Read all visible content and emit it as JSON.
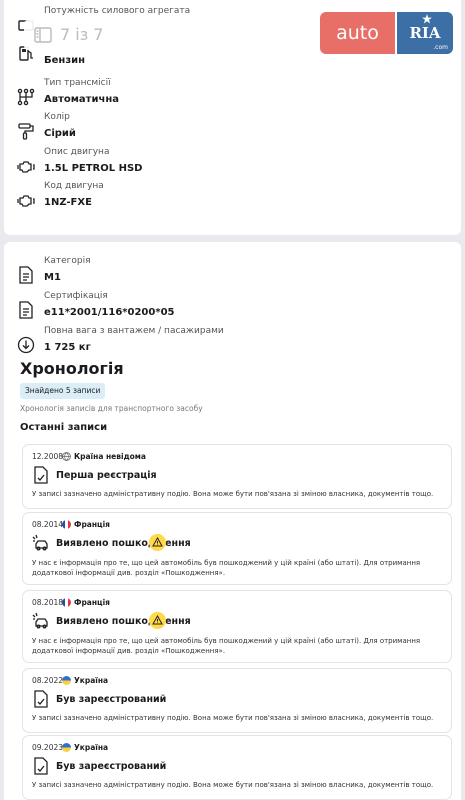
{
  "vehicle_specs": [
    {
      "label": "Потужність силового агрегата",
      "value": "",
      "icon": "engine-power-icon"
    },
    {
      "label": "",
      "value": "Бензин",
      "icon": "fuel-pump-icon"
    },
    {
      "label": "Тип трансмісії",
      "value": "Автоматична",
      "icon": "transmission-icon"
    },
    {
      "label": "Колір",
      "value": "Сірий",
      "icon": "paint-roller-icon"
    },
    {
      "label": "Опис двигуна",
      "value": "1.5L PETROL HSD",
      "icon": "engine-icon"
    },
    {
      "label": "Код двигуна",
      "value": "1NZ-FXE",
      "icon": "engine-icon"
    }
  ],
  "gallery": {
    "counter": "7 із 7",
    "icon": "gallery-icon"
  },
  "logo": {
    "auto": "auto",
    "ria": "RIA",
    "com": ".com"
  },
  "registration_specs": [
    {
      "label": "Категорія",
      "value": "M1",
      "icon": "document-icon"
    },
    {
      "label": "Сертифікація",
      "value": "e11*2001/116*0200*05",
      "icon": "document-icon"
    },
    {
      "label": "Повна вага з вантажем / пасажирами",
      "value": "1 725 кг",
      "icon": "weight-icon"
    }
  ],
  "history": {
    "title": "Хронологія",
    "badge": "Знайдено 5 записи",
    "subtitle": "Хронологія записів для транспортного засобу",
    "recent_title": "Останні записи",
    "records": [
      {
        "date": "12.2008",
        "country": "Країна невідома",
        "flag": "globe",
        "title": "Перша реєстрація",
        "icon": "registration-document-icon",
        "warning": false,
        "desc": "У записі зазначено адміністративну подію. Вона може бути пов'язана зі зміною власника, документів тощо."
      },
      {
        "date": "08.2014",
        "country": "Франція",
        "flag": "fr",
        "title": "Виявлено пошкодження",
        "icon": "car-crash-icon",
        "warning": true,
        "desc": "У нас є інформація про те, що цей автомобіль був пошкоджений у цій країні (або штаті). Для отримання додаткової інформації див. розділ «Пошкодження»."
      },
      {
        "date": "08.2018",
        "country": "Франція",
        "flag": "fr",
        "title": "Виявлено пошкодження",
        "icon": "car-crash-icon",
        "warning": true,
        "desc": "У нас є інформація про те, що цей автомобіль був пошкоджений у цій країні (або штаті). Для отримання додаткової інформації див. розділ «Пошкодження»."
      },
      {
        "date": "08.2022",
        "country": "Україна",
        "flag": "ua",
        "title": "Був зареєстрований",
        "icon": "registration-document-icon",
        "warning": false,
        "desc": "У записі зазначено адміністративну подію. Вона може бути пов'язана зі зміною власника, документів тощо."
      },
      {
        "date": "09.2023",
        "country": "Україна",
        "flag": "ua",
        "title": "Був зареєстрований",
        "icon": "registration-document-icon",
        "warning": false,
        "desc": "У записі зазначено адміністративну подію. Вона може бути пов'язана зі зміною власника, документів тощо."
      }
    ]
  },
  "colors": {
    "logo_red": "#e86f68",
    "logo_blue": "#3c6fa6",
    "badge_bg": "#dbeef8",
    "warning": "#ffd94a"
  }
}
